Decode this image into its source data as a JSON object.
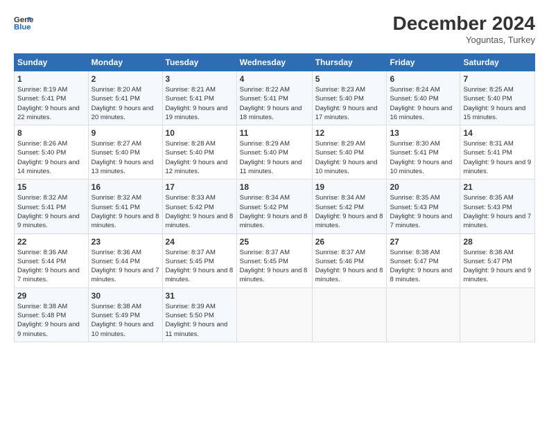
{
  "header": {
    "logo_general": "General",
    "logo_blue": "Blue",
    "month_title": "December 2024",
    "subtitle": "Yoguntas, Turkey"
  },
  "days_of_week": [
    "Sunday",
    "Monday",
    "Tuesday",
    "Wednesday",
    "Thursday",
    "Friday",
    "Saturday"
  ],
  "weeks": [
    [
      {
        "day": "1",
        "sunrise": "Sunrise: 8:19 AM",
        "sunset": "Sunset: 5:41 PM",
        "daylight": "Daylight: 9 hours and 22 minutes."
      },
      {
        "day": "2",
        "sunrise": "Sunrise: 8:20 AM",
        "sunset": "Sunset: 5:41 PM",
        "daylight": "Daylight: 9 hours and 20 minutes."
      },
      {
        "day": "3",
        "sunrise": "Sunrise: 8:21 AM",
        "sunset": "Sunset: 5:41 PM",
        "daylight": "Daylight: 9 hours and 19 minutes."
      },
      {
        "day": "4",
        "sunrise": "Sunrise: 8:22 AM",
        "sunset": "Sunset: 5:41 PM",
        "daylight": "Daylight: 9 hours and 18 minutes."
      },
      {
        "day": "5",
        "sunrise": "Sunrise: 8:23 AM",
        "sunset": "Sunset: 5:40 PM",
        "daylight": "Daylight: 9 hours and 17 minutes."
      },
      {
        "day": "6",
        "sunrise": "Sunrise: 8:24 AM",
        "sunset": "Sunset: 5:40 PM",
        "daylight": "Daylight: 9 hours and 16 minutes."
      },
      {
        "day": "7",
        "sunrise": "Sunrise: 8:25 AM",
        "sunset": "Sunset: 5:40 PM",
        "daylight": "Daylight: 9 hours and 15 minutes."
      }
    ],
    [
      {
        "day": "8",
        "sunrise": "Sunrise: 8:26 AM",
        "sunset": "Sunset: 5:40 PM",
        "daylight": "Daylight: 9 hours and 14 minutes."
      },
      {
        "day": "9",
        "sunrise": "Sunrise: 8:27 AM",
        "sunset": "Sunset: 5:40 PM",
        "daylight": "Daylight: 9 hours and 13 minutes."
      },
      {
        "day": "10",
        "sunrise": "Sunrise: 8:28 AM",
        "sunset": "Sunset: 5:40 PM",
        "daylight": "Daylight: 9 hours and 12 minutes."
      },
      {
        "day": "11",
        "sunrise": "Sunrise: 8:29 AM",
        "sunset": "Sunset: 5:40 PM",
        "daylight": "Daylight: 9 hours and 11 minutes."
      },
      {
        "day": "12",
        "sunrise": "Sunrise: 8:29 AM",
        "sunset": "Sunset: 5:40 PM",
        "daylight": "Daylight: 9 hours and 10 minutes."
      },
      {
        "day": "13",
        "sunrise": "Sunrise: 8:30 AM",
        "sunset": "Sunset: 5:41 PM",
        "daylight": "Daylight: 9 hours and 10 minutes."
      },
      {
        "day": "14",
        "sunrise": "Sunrise: 8:31 AM",
        "sunset": "Sunset: 5:41 PM",
        "daylight": "Daylight: 9 hours and 9 minutes."
      }
    ],
    [
      {
        "day": "15",
        "sunrise": "Sunrise: 8:32 AM",
        "sunset": "Sunset: 5:41 PM",
        "daylight": "Daylight: 9 hours and 9 minutes."
      },
      {
        "day": "16",
        "sunrise": "Sunrise: 8:32 AM",
        "sunset": "Sunset: 5:41 PM",
        "daylight": "Daylight: 9 hours and 8 minutes."
      },
      {
        "day": "17",
        "sunrise": "Sunrise: 8:33 AM",
        "sunset": "Sunset: 5:42 PM",
        "daylight": "Daylight: 9 hours and 8 minutes."
      },
      {
        "day": "18",
        "sunrise": "Sunrise: 8:34 AM",
        "sunset": "Sunset: 5:42 PM",
        "daylight": "Daylight: 9 hours and 8 minutes."
      },
      {
        "day": "19",
        "sunrise": "Sunrise: 8:34 AM",
        "sunset": "Sunset: 5:42 PM",
        "daylight": "Daylight: 9 hours and 8 minutes."
      },
      {
        "day": "20",
        "sunrise": "Sunrise: 8:35 AM",
        "sunset": "Sunset: 5:43 PM",
        "daylight": "Daylight: 9 hours and 7 minutes."
      },
      {
        "day": "21",
        "sunrise": "Sunrise: 8:35 AM",
        "sunset": "Sunset: 5:43 PM",
        "daylight": "Daylight: 9 hours and 7 minutes."
      }
    ],
    [
      {
        "day": "22",
        "sunrise": "Sunrise: 8:36 AM",
        "sunset": "Sunset: 5:44 PM",
        "daylight": "Daylight: 9 hours and 7 minutes."
      },
      {
        "day": "23",
        "sunrise": "Sunrise: 8:36 AM",
        "sunset": "Sunset: 5:44 PM",
        "daylight": "Daylight: 9 hours and 7 minutes."
      },
      {
        "day": "24",
        "sunrise": "Sunrise: 8:37 AM",
        "sunset": "Sunset: 5:45 PM",
        "daylight": "Daylight: 9 hours and 8 minutes."
      },
      {
        "day": "25",
        "sunrise": "Sunrise: 8:37 AM",
        "sunset": "Sunset: 5:45 PM",
        "daylight": "Daylight: 9 hours and 8 minutes."
      },
      {
        "day": "26",
        "sunrise": "Sunrise: 8:37 AM",
        "sunset": "Sunset: 5:46 PM",
        "daylight": "Daylight: 9 hours and 8 minutes."
      },
      {
        "day": "27",
        "sunrise": "Sunrise: 8:38 AM",
        "sunset": "Sunset: 5:47 PM",
        "daylight": "Daylight: 9 hours and 8 minutes."
      },
      {
        "day": "28",
        "sunrise": "Sunrise: 8:38 AM",
        "sunset": "Sunset: 5:47 PM",
        "daylight": "Daylight: 9 hours and 9 minutes."
      }
    ],
    [
      {
        "day": "29",
        "sunrise": "Sunrise: 8:38 AM",
        "sunset": "Sunset: 5:48 PM",
        "daylight": "Daylight: 9 hours and 9 minutes."
      },
      {
        "day": "30",
        "sunrise": "Sunrise: 8:38 AM",
        "sunset": "Sunset: 5:49 PM",
        "daylight": "Daylight: 9 hours and 10 minutes."
      },
      {
        "day": "31",
        "sunrise": "Sunrise: 8:39 AM",
        "sunset": "Sunset: 5:50 PM",
        "daylight": "Daylight: 9 hours and 11 minutes."
      },
      null,
      null,
      null,
      null
    ]
  ]
}
